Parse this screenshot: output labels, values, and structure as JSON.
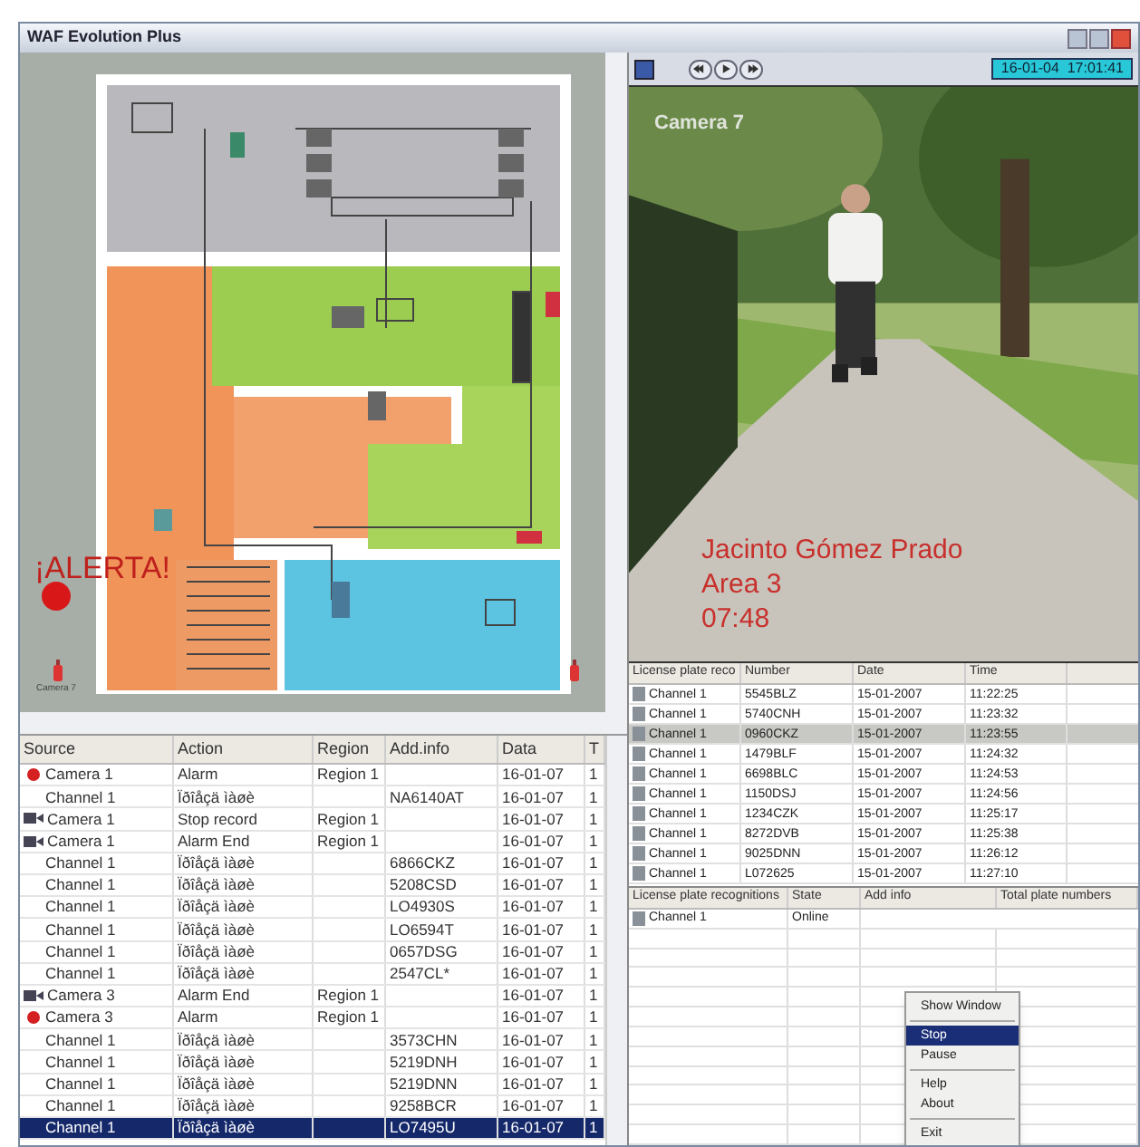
{
  "window": {
    "title": "WAF Evolution Plus"
  },
  "map": {
    "alert": "¡ALERTA!",
    "camera_label": "Camera 7"
  },
  "event_log": {
    "columns": [
      "Source",
      "Action",
      "Region",
      "Add.info",
      "Data",
      "T"
    ],
    "rows": [
      {
        "kind": "alarm",
        "selected": false,
        "source": "Camera 1",
        "action": "Alarm",
        "region": "Region 1",
        "date": "16-01-07",
        "time": "1"
      },
      {
        "kind": "channel",
        "selected": false,
        "source": "Channel 1",
        "action": "Ïðîåçä ìàøè",
        "info": "NA6140AT",
        "date": "16-01-07",
        "time": "1"
      },
      {
        "kind": "camera",
        "selected": false,
        "source": "Camera 1",
        "action": "Stop record",
        "region": "Region 1",
        "date": "16-01-07",
        "time": "1"
      },
      {
        "kind": "camera",
        "selected": false,
        "source": "Camera 1",
        "action": "Alarm End",
        "region": "Region 1",
        "date": "16-01-07",
        "time": "1"
      },
      {
        "kind": "channel",
        "selected": false,
        "source": "Channel 1",
        "action": "Ïðîåçä ìàøè",
        "info": "6866CKZ",
        "date": "16-01-07",
        "time": "1"
      },
      {
        "kind": "channel",
        "selected": false,
        "source": "Channel 1",
        "action": "Ïðîåçä ìàøè",
        "info": "5208CSD",
        "date": "16-01-07",
        "time": "1"
      },
      {
        "kind": "channel",
        "selected": false,
        "source": "Channel 1",
        "action": "Ïðîåçä ìàøè",
        "info": "LO4930S",
        "date": "16-01-07",
        "time": "1"
      },
      {
        "kind": "channel",
        "selected": false,
        "source": "Channel 1",
        "action": "Ïðîåçä ìàøè",
        "info": "LO6594T",
        "date": "16-01-07",
        "time": "1"
      },
      {
        "kind": "channel",
        "selected": false,
        "source": "Channel 1",
        "action": "Ïðîåçä ìàøè",
        "info": "0657DSG",
        "date": "16-01-07",
        "time": "1"
      },
      {
        "kind": "channel",
        "selected": false,
        "source": "Channel 1",
        "action": "Ïðîåçä ìàøè",
        "info": "2547CL*",
        "date": "16-01-07",
        "time": "1"
      },
      {
        "kind": "camera",
        "selected": false,
        "source": "Camera 3",
        "action": "Alarm End",
        "region": "Region 1",
        "date": "16-01-07",
        "time": "1"
      },
      {
        "kind": "alarm",
        "selected": false,
        "source": "Camera 3",
        "action": "Alarm",
        "region": "Region 1",
        "date": "16-01-07",
        "time": "1"
      },
      {
        "kind": "channel",
        "selected": false,
        "source": "Channel 1",
        "action": "Ïðîåçä ìàøè",
        "info": "3573CHN",
        "date": "16-01-07",
        "time": "1"
      },
      {
        "kind": "channel",
        "selected": false,
        "source": "Channel 1",
        "action": "Ïðîåçä ìàøè",
        "info": "5219DNH",
        "date": "16-01-07",
        "time": "1"
      },
      {
        "kind": "channel",
        "selected": false,
        "source": "Channel 1",
        "action": "Ïðîåçä ìàøè",
        "info": "5219DNN",
        "date": "16-01-07",
        "time": "1"
      },
      {
        "kind": "channel",
        "selected": false,
        "source": "Channel 1",
        "action": "Ïðîåçä ìàøè",
        "info": "9258BCR",
        "date": "16-01-07",
        "time": "1"
      },
      {
        "kind": "channel",
        "selected": true,
        "source": "Channel 1",
        "action": "Ïðîåçä ìàøè",
        "info": "LO7495U",
        "date": "16-01-07",
        "time": "1"
      }
    ]
  },
  "toolbar": {
    "datetime": "16-01-04  17:01:41"
  },
  "video": {
    "camera": "Camera 7",
    "overlay": [
      "Jacinto Gómez Prado",
      "Area 3",
      "07:48"
    ]
  },
  "plate_log": {
    "columns": [
      "License plate reco",
      "Number",
      "Date",
      "Time"
    ],
    "rows": [
      {
        "selected": false,
        "cells": [
          "Channel 1",
          "5545BLZ",
          "15-01-2007",
          "11:22:25"
        ]
      },
      {
        "selected": false,
        "cells": [
          "Channel 1",
          "5740CNH",
          "15-01-2007",
          "11:23:32"
        ]
      },
      {
        "selected": true,
        "cells": [
          "Channel 1",
          "0960CKZ",
          "15-01-2007",
          "11:23:55"
        ]
      },
      {
        "selected": false,
        "cells": [
          "Channel 1",
          "1479BLF",
          "15-01-2007",
          "11:24:32"
        ]
      },
      {
        "selected": false,
        "cells": [
          "Channel 1",
          "6698BLC",
          "15-01-2007",
          "11:24:53"
        ]
      },
      {
        "selected": false,
        "cells": [
          "Channel 1",
          "1150DSJ",
          "15-01-2007",
          "11:24:56"
        ]
      },
      {
        "selected": false,
        "cells": [
          "Channel 1",
          "1234CZK",
          "15-01-2007",
          "11:25:17"
        ]
      },
      {
        "selected": false,
        "cells": [
          "Channel 1",
          "8272DVB",
          "15-01-2007",
          "11:25:38"
        ]
      },
      {
        "selected": false,
        "cells": [
          "Channel 1",
          "9025DNN",
          "15-01-2007",
          "11:26:12"
        ]
      },
      {
        "selected": false,
        "cells": [
          "Channel 1",
          "L072625",
          "15-01-2007",
          "11:27:10"
        ]
      }
    ]
  },
  "recognizers": {
    "columns": [
      "License plate recognitions",
      "State",
      "Add info",
      "Total plate numbers"
    ],
    "rows": [
      {
        "cells": [
          "Channel 1",
          "Online"
        ]
      }
    ]
  },
  "context_menu": {
    "items": [
      {
        "label": "Show Window",
        "selected": false,
        "separator_after": true
      },
      {
        "label": "Stop",
        "selected": true,
        "separator_after": false
      },
      {
        "label": "Pause",
        "selected": false,
        "separator_after": true
      },
      {
        "label": "Help",
        "selected": false,
        "separator_after": false
      },
      {
        "label": "About",
        "selected": false,
        "separator_after": true
      },
      {
        "label": "Exit",
        "selected": false,
        "separator_after": false
      }
    ]
  }
}
